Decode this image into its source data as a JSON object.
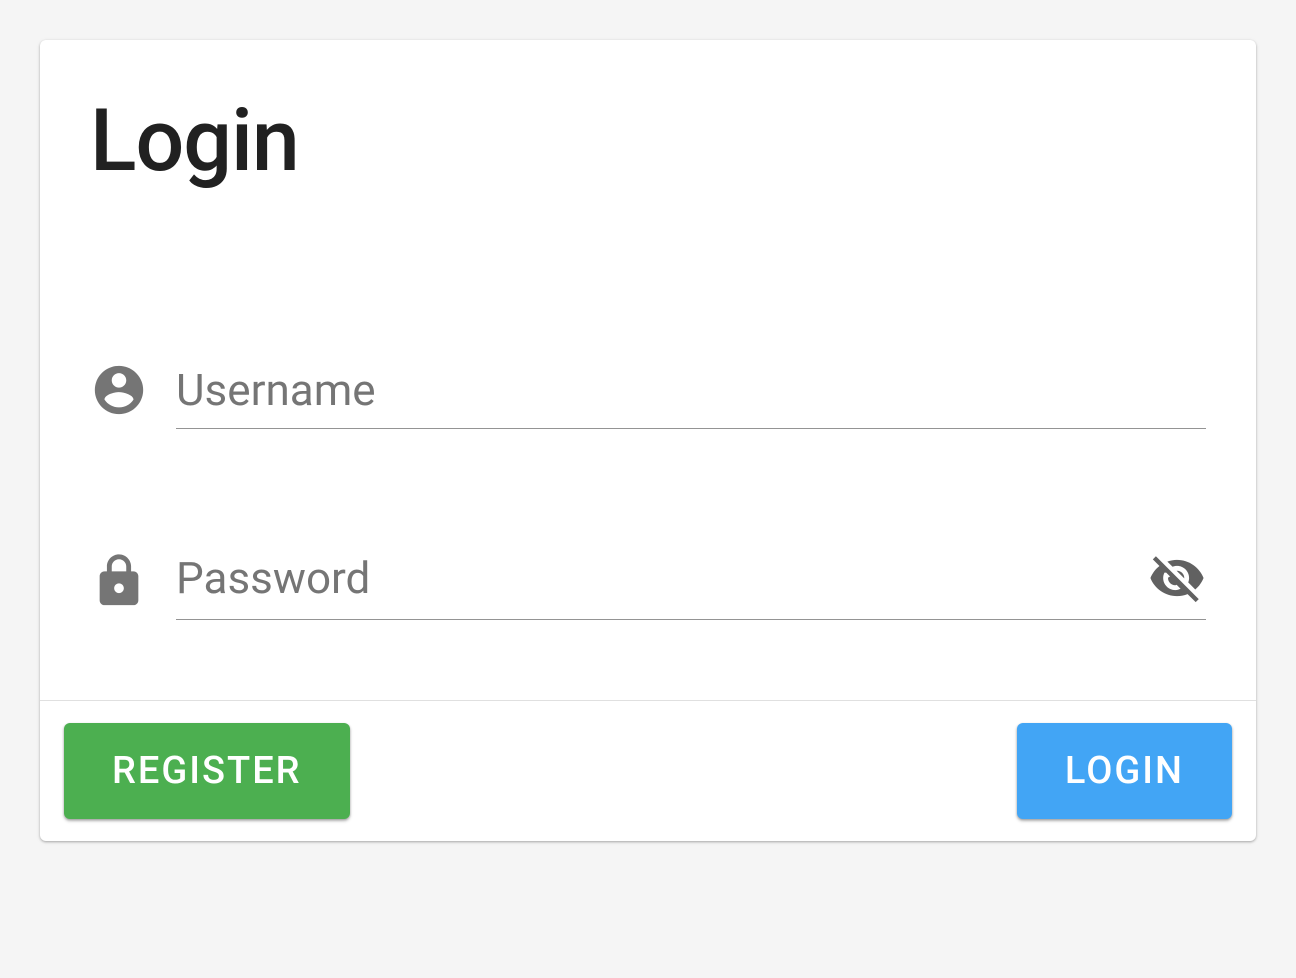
{
  "card": {
    "title": "Login",
    "username": {
      "placeholder": "Username",
      "value": ""
    },
    "password": {
      "placeholder": "Password",
      "value": ""
    },
    "actions": {
      "register_label": "Register",
      "login_label": "Login"
    }
  }
}
